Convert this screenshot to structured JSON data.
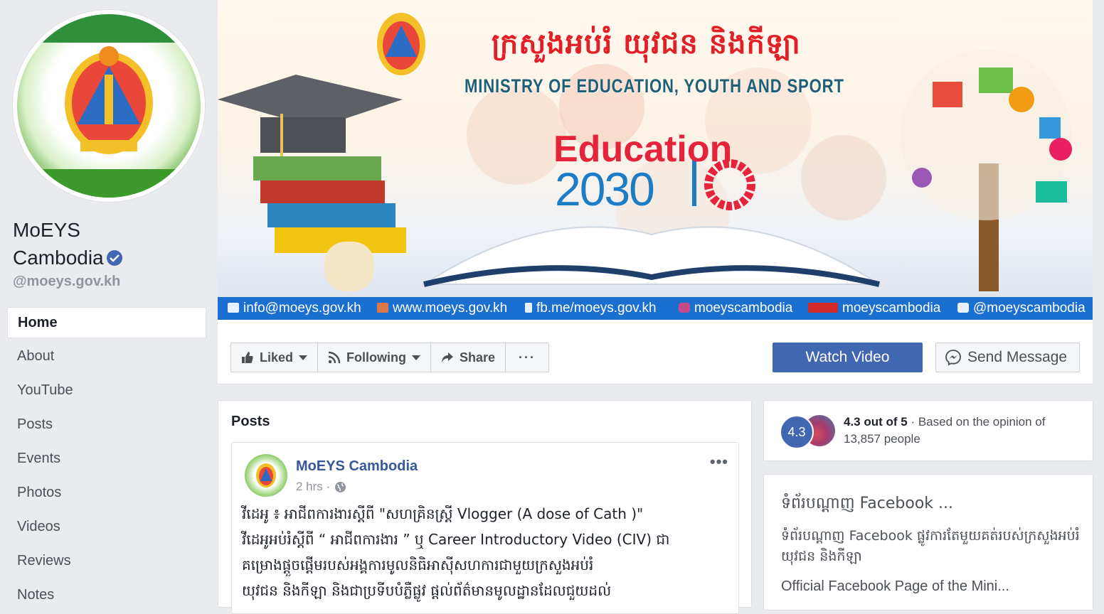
{
  "page": {
    "name_line1": "MoEYS",
    "name_line2": "Cambodia",
    "handle": "@moeys.gov.kh"
  },
  "nav": {
    "items": [
      {
        "label": "Home",
        "active": true
      },
      {
        "label": "About"
      },
      {
        "label": "YouTube"
      },
      {
        "label": "Posts"
      },
      {
        "label": "Events"
      },
      {
        "label": "Photos"
      },
      {
        "label": "Videos"
      },
      {
        "label": "Reviews"
      },
      {
        "label": "Notes"
      }
    ]
  },
  "cover": {
    "title_kh": "ក្រសួងអប់រំ យុវជន និងកីឡា",
    "title_en": "MINISTRY OF EDUCATION, YOUTH AND SPORT",
    "education_word": "Education",
    "year": "2030",
    "contacts": {
      "email": "info@moeys.gov.kh",
      "website": "www.moeys.gov.kh",
      "facebook": "fb.me/moeys.gov.kh",
      "instagram": "moeyscambodia",
      "youtube": "moeyscambodia",
      "twitter": "@moeyscambodia"
    }
  },
  "actions": {
    "liked": "Liked",
    "following": "Following",
    "share": "Share",
    "more": "···",
    "watch_video": "Watch Video",
    "send_message": "Send Message"
  },
  "posts": {
    "section_title": "Posts",
    "items": [
      {
        "author": "MoEYS Cambodia",
        "time": "2 hrs ·",
        "line1": "វីដេអូ ៖ អាជីពការងារស្តីពី \"សហគ្រិនស្ត្រី Vlogger (A dose of Cath )\"",
        "line2": "វីដេអូអប់រំស្តីពី “ អាជីពការងារ ” ឬ Career Introductory Video (CIV) ជា",
        "line3": "គម្រោងផ្តួចផ្តើមរបស់អង្គការមូលនិធិអាស៊ីសហការជាមួយក្រសួងអប់រំ",
        "line4": "យុវជន និងកីឡា និងជាប្រទីបបំភ្លឺផ្លូវ ផ្តល់ព័ត៌មានមូលដ្ឋានដែលជួយដល់"
      }
    ]
  },
  "rating": {
    "score": "4.3",
    "headline": "4.3 out of 5",
    "detail": " · Based on the opinion of 13,857 people"
  },
  "about": {
    "title": "ទំព័របណ្តាញ Facebook ...",
    "description": "ទំព័របណ្តាញ Facebook ផ្លូវការតែមួយគត់របស់ក្រសួងអប់រំ យុវជន និងកីឡា",
    "link": "Official Facebook Page of the Mini..."
  },
  "colors": {
    "fb_blue": "#4267b2",
    "link_blue": "#365899",
    "contact_bar": "#1a6fd1",
    "education_red": "#e5243b",
    "year_blue": "#1c7dc6"
  }
}
